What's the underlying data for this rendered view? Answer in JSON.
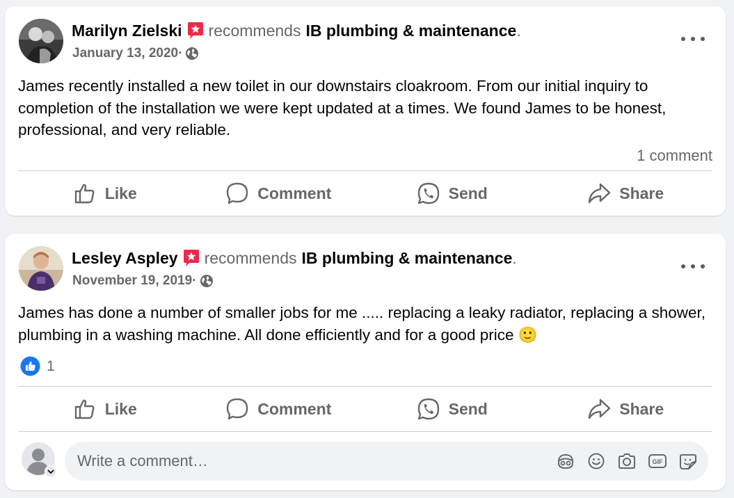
{
  "colors": {
    "text_primary": "#050505",
    "text_secondary": "#65676b",
    "recommend_badge": "#f02849",
    "like_blue": "#1877f2",
    "background": "#f0f2f5"
  },
  "posts": [
    {
      "author": "Marilyn Zielski",
      "recommends_text": "recommends",
      "page_name": "IB plumbing & maintenance",
      "period": ".",
      "date": "January 13, 2020",
      "date_sep": "·",
      "body": "James recently installed a new toilet in our downstairs cloakroom. From our initial inquiry to completion of the installation we were kept updated at a times. We found James to be honest, professional, and very reliable.",
      "comments_count": "1 comment",
      "actions": {
        "like": "Like",
        "comment": "Comment",
        "send": "Send",
        "share": "Share"
      }
    },
    {
      "author": "Lesley Aspley",
      "recommends_text": "recommends",
      "page_name": "IB plumbing & maintenance",
      "period": ".",
      "date": "November 19, 2019",
      "date_sep": "·",
      "body": "James has done a number of smaller jobs for me ..... replacing a leaky radiator, replacing a shower, plumbing in a washing machine. All done efficiently and for a good price 🙂",
      "reaction_count": "1",
      "actions": {
        "like": "Like",
        "comment": "Comment",
        "send": "Send",
        "share": "Share"
      }
    }
  ],
  "composer": {
    "placeholder": "Write a comment…",
    "tool_icons": [
      "avatar-sticker-icon",
      "emoji-icon",
      "camera-icon",
      "gif-icon",
      "sticker-icon"
    ]
  }
}
